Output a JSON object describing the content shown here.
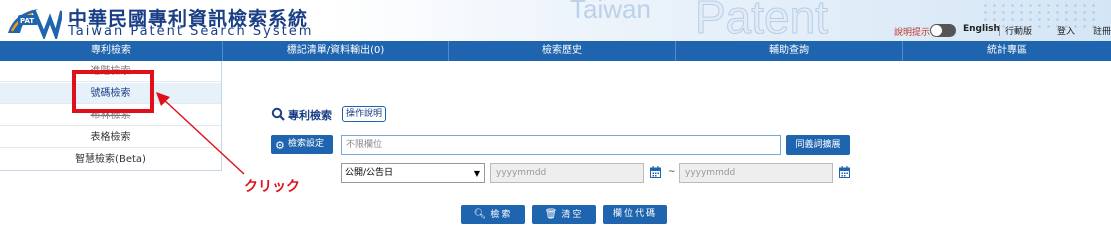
{
  "header": {
    "logo_text": "PAT",
    "title_zh": "中華民國專利資訊檢索系統",
    "title_en": "Taiwan Patent Search System",
    "watermark_taiwan": "Taiwan",
    "watermark_patent": "Patent",
    "hint_label": "說明提示",
    "links": [
      "English",
      "行動版",
      "登入",
      "註冊"
    ]
  },
  "nav": {
    "items": [
      "專利檢索",
      "標記清單/資料輸出(0)",
      "檢索歷史",
      "輔助查詢",
      "統計專區"
    ]
  },
  "side_menu": {
    "items": [
      "進階檢索",
      "號碼檢索",
      "布林檢索",
      "表格檢索",
      "智慧檢索(Beta)"
    ],
    "active_index": 1
  },
  "annotation": {
    "click_label": "クリック",
    "highlight_color": "#e0101a"
  },
  "search": {
    "title": "專利檢索",
    "help_label": "操作說明",
    "settings_label": "檢索設定",
    "main_input_placeholder": "不限欄位",
    "synonym_label": "同義詞擴展",
    "date_field_selected": "公開/公告日",
    "date_from_placeholder": "yyyymmdd",
    "date_to_placeholder": "yyyymmdd",
    "range_sep": "~",
    "search_label": "檢索",
    "clear_label": "清空",
    "field_codes_label": "欄位代碼"
  },
  "colors": {
    "primary": "#1f64ae",
    "brand_text": "#1a3f86",
    "accent_red": "#e0101a"
  }
}
